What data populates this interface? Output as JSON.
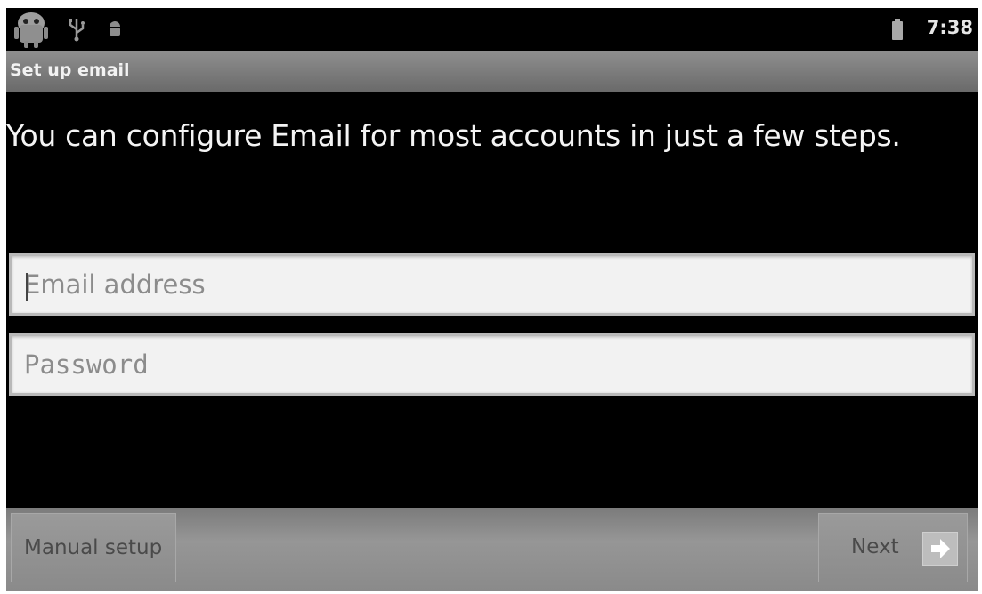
{
  "status_bar": {
    "icons": [
      "android-icon",
      "usb-icon",
      "android-small-icon",
      "battery-icon"
    ],
    "time": "7:38"
  },
  "title_bar": {
    "title": "Set up email"
  },
  "intro": {
    "text": "You can configure Email for most accounts in just a few steps."
  },
  "form": {
    "email_placeholder": "Email address",
    "email_value": "",
    "password_placeholder": "Password",
    "password_value": ""
  },
  "bottom_bar": {
    "manual_setup_label": "Manual setup",
    "next_label": "Next",
    "next_icon": "arrow-right-icon"
  },
  "colors": {
    "background": "#000000",
    "title_bar": "#7c7c7c",
    "field_background": "#f2f2f2",
    "bottom_bar": "#8a8a8a"
  }
}
